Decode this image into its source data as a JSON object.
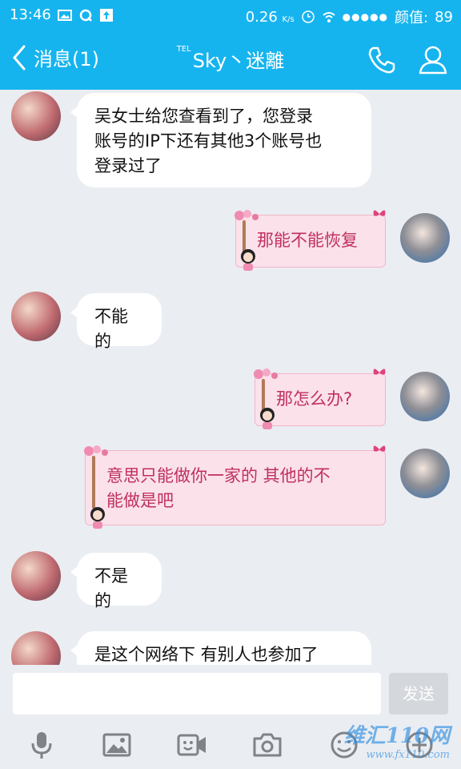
{
  "status_bar": {
    "time": "13:46",
    "speed": "0.26",
    "speed_unit": "K/s",
    "signal_dots": "●●●●●",
    "carrier": "颜值:",
    "battery": "89"
  },
  "header": {
    "back_label": "消息(1)",
    "tel_tag": "TEL",
    "contact_name": "Sky丶迷離"
  },
  "messages": [
    {
      "side": "left",
      "text_lines": [
        "吴女士给您查看到了，您登录",
        "账号的IP下还有其他3个账号也",
        "登录过了"
      ]
    },
    {
      "side": "right",
      "text_lines": [
        "那能不能恢复"
      ]
    },
    {
      "side": "left",
      "text_lines": [
        "不能的"
      ]
    },
    {
      "side": "right",
      "text_lines": [
        "那怎么办?"
      ]
    },
    {
      "side": "right",
      "text_lines": [
        "意思只能做你一家的 其他的不",
        "能做是吧"
      ]
    },
    {
      "side": "left",
      "text_lines": [
        "不是的"
      ]
    },
    {
      "side": "left",
      "text_lines": [
        "是这个网络下 有别人也参加了"
      ]
    }
  ],
  "input_bar": {
    "send_label": "发送"
  },
  "toolbar_icons": [
    "mic-icon",
    "image-icon",
    "video-call-icon",
    "camera-icon",
    "emoji-icon",
    "plus-icon"
  ],
  "watermark": {
    "brand": "维汇110网",
    "url": "www.fx110.com"
  },
  "colors": {
    "header_bg": "#16b4ee",
    "chat_bg": "#eaedf2",
    "pink_bubble": "#fbe1ea",
    "pink_text": "#c0305e"
  }
}
